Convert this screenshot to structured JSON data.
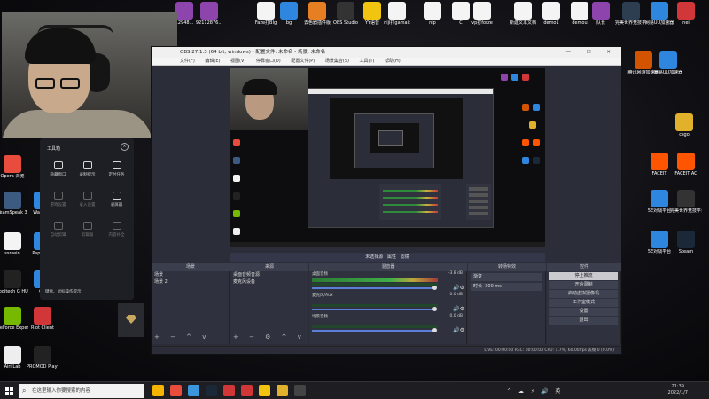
{
  "desktop_icons": [
    {
      "label": "网易",
      "color": "#c0392b"
    },
    {
      "label": "Mic",
      "color": "#2e86de"
    },
    {
      "label": "腾讯QQ",
      "color": "#2e86de"
    },
    {
      "label": "QQ",
      "color": "#111111"
    },
    {
      "label": "Opera 浏览",
      "color": "#e74c3c"
    },
    {
      "label": "TeamSpeak 3",
      "color": "#3d5a80"
    },
    {
      "label": "Wal Engi",
      "color": "#2e86de"
    },
    {
      "label": "ssr-win",
      "color": "#f4f4f4"
    },
    {
      "label": "Pape Eng",
      "color": "#2e86de"
    },
    {
      "label": "Logitech G HUB",
      "color": "#222222"
    },
    {
      "label": "QQ",
      "color": "#2e86de"
    },
    {
      "label": "GeForce Experience",
      "color": "#76b900"
    },
    {
      "label": "Riot Client",
      "color": "#d13639"
    },
    {
      "label": "Airi Lab",
      "color": "#eeeeee"
    },
    {
      "label": "PROMOD Playtest",
      "color": "#222222"
    }
  ],
  "top_icons": [
    {
      "label": "12948...",
      "color": "#8e44ad"
    },
    {
      "label": "92112876...",
      "color": "#8e44ad"
    },
    {
      "label": "Faze打BIg",
      "color": "#f4f4f4"
    },
    {
      "label": "bg",
      "color": "#2e86de"
    },
    {
      "label": "去色器插件版",
      "color": "#e67e22"
    },
    {
      "label": "OBS Studio",
      "color": "#333333"
    },
    {
      "label": "YY语音",
      "color": "#f1c40f"
    },
    {
      "label": "niji打gamait",
      "color": "#f4f4f4"
    },
    {
      "label": "nip",
      "color": "#f4f4f4"
    },
    {
      "label": "C",
      "color": "#f4f4f4"
    },
    {
      "label": "vp打forze",
      "color": "#f4f4f4"
    },
    {
      "label": "新建文本文档",
      "color": "#f4f4f4"
    },
    {
      "label": "demo1",
      "color": "#f4f4f4"
    },
    {
      "label": "demou",
      "color": "#f4f4f4"
    },
    {
      "label": "队长",
      "color": "#8e44ad"
    },
    {
      "label": "完美世界竞技平台",
      "color": "#2c3e50"
    },
    {
      "label": "网易UU加速器",
      "color": "#2e86de"
    },
    {
      "label": "nei",
      "color": "#d13639"
    }
  ],
  "right_icons": [
    {
      "label": "腾讯网游加速器",
      "color": "#d35400"
    },
    {
      "label": "网易UU加速器",
      "color": "#2e86de"
    },
    {
      "label": "csgo",
      "color": "#e1b12c"
    },
    {
      "label": "FACEIT",
      "color": "#ff5500"
    },
    {
      "label": "FACEIT AC",
      "color": "#ff5500"
    },
    {
      "label": "5E对战平台",
      "color": "#2e86de"
    },
    {
      "label": "完美世界竞技平台",
      "color": "#333333"
    },
    {
      "label": "5E对战平台",
      "color": "#2e86de"
    },
    {
      "label": "Steam",
      "color": "#1b2838"
    }
  ],
  "obs": {
    "title": "OBS 27.1.3 (64 bit, windows) - 配置文件: 未命名 - 场景: 未命名",
    "window_controls": "— ☐ ✕",
    "menu": [
      "文件(F)",
      "编辑(E)",
      "视图(V)",
      "停靠窗口(D)",
      "配置文件(P)",
      "场景集合(S)",
      "工具(T)",
      "帮助(H)"
    ],
    "source_bar": "未选择源",
    "properties_label": "属性",
    "filters_label": "滤镜",
    "docks": {
      "scenes": "场景",
      "sources": "来源",
      "mixer": "混音器",
      "transitions": "转场特效",
      "controls": "控件"
    },
    "scenes": [
      "场景",
      "场景 2"
    ],
    "sources": [
      "桌面音频音源",
      "麦克风设备"
    ],
    "mixer": [
      {
        "name": "桌面音频",
        "db": "-3.8 dB"
      },
      {
        "name": "麦克风/Aux",
        "db": "0.0 dB"
      },
      {
        "name": "场景音频",
        "db": "0.0 dB"
      },
      {
        "name": "桌面音频 2",
        "db": "0.0 dB"
      }
    ],
    "transition_value": "渐变",
    "duration_label": "时长",
    "duration_value": "300 ms",
    "controls": [
      "停止推流",
      "开始录制",
      "启动虚拟摄像机",
      "工作室模式",
      "设置",
      "退出"
    ],
    "status": "LIVE: 00:00:00   REC: 00:00:00   CPU: 1.7%, 60.00 fps   丢帧 0 (0.0%)"
  },
  "toolbox": {
    "title": "工具箱",
    "close": "×",
    "items": [
      {
        "label": "隐藏窗口",
        "dim": false
      },
      {
        "label": "录制提示",
        "dim": false
      },
      {
        "label": "定时任务",
        "dim": false
      },
      {
        "label": "游戏设置",
        "dim": true
      },
      {
        "label": "录入设置",
        "dim": true
      },
      {
        "label": "录屏器",
        "dim": false
      },
      {
        "label": "自动剪辑",
        "dim": true
      },
      {
        "label": "剪辑器",
        "dim": true
      },
      {
        "label": "内容补全",
        "dim": true
      }
    ],
    "tip": "键盘、鼠标操作提示"
  },
  "taskbar": {
    "search_placeholder": "在这里输入你要搜索的内容",
    "apps": [
      {
        "name": "file-explorer",
        "color": "#f4b400"
      },
      {
        "name": "opera",
        "color": "#e74c3c"
      },
      {
        "name": "edge",
        "color": "#3a96dd"
      },
      {
        "name": "steam",
        "color": "#1b2838"
      },
      {
        "name": "netease-music",
        "color": "#d13639"
      },
      {
        "name": "riot",
        "color": "#d13639"
      },
      {
        "name": "folder",
        "color": "#f1c40f"
      },
      {
        "name": "csgo",
        "color": "#e1b12c"
      },
      {
        "name": "obs",
        "color": "#444444"
      }
    ],
    "tray": "^ ☁ ⚡ 🔊 英",
    "time": "21:39",
    "date": "2022/1/7"
  }
}
